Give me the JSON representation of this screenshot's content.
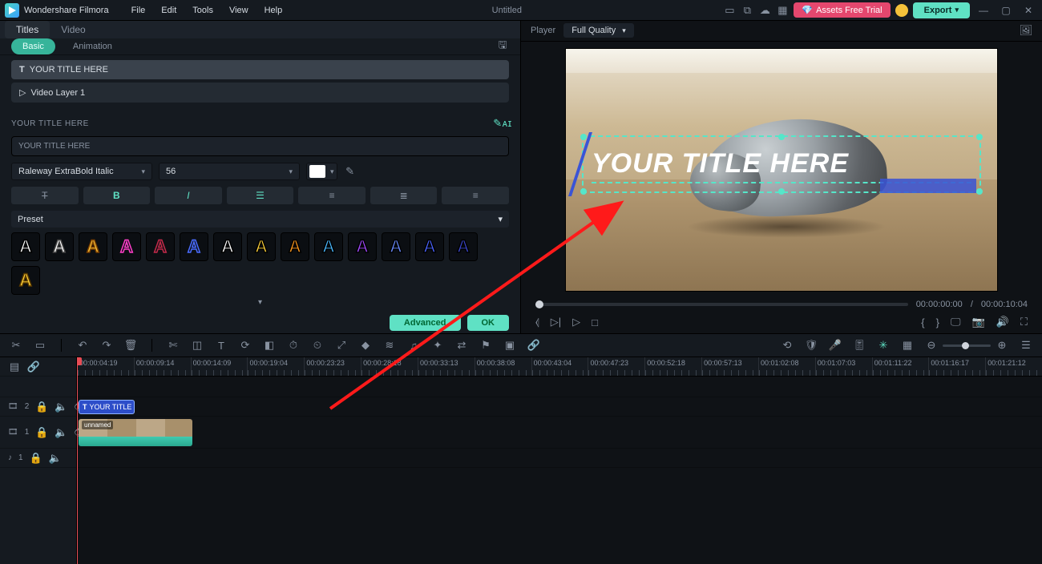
{
  "app": {
    "name": "Wondershare Filmora",
    "doc_title": "Untitled"
  },
  "menu": {
    "file": "File",
    "edit": "Edit",
    "tools": "Tools",
    "view": "View",
    "help": "Help"
  },
  "header_buttons": {
    "assets": "Assets Free Trial",
    "export": "Export"
  },
  "left": {
    "tabs": {
      "titles": "Titles",
      "video": "Video"
    },
    "subtabs": {
      "basic": "Basic",
      "animation": "Animation"
    },
    "layers": {
      "title": "YOUR TITLE HERE",
      "video": "Video Layer 1"
    },
    "section_label": "YOUR TITLE HERE",
    "text_value": "YOUR TITLE HERE",
    "font": {
      "family": "Raleway ExtraBold Italic",
      "size": "56"
    },
    "preset_label": "Preset",
    "buttons": {
      "advanced": "Advanced",
      "ok": "OK"
    }
  },
  "player": {
    "label": "Player",
    "quality": "Full Quality",
    "title_overlay": "YOUR TITLE HERE",
    "time_current": "00:00:00:00",
    "time_total": "00:00:10:04",
    "time_sep": "/"
  },
  "timeline": {
    "ticks": [
      "00:00:04:19",
      "00:00:09:14",
      "00:00:14:09",
      "00:00:19:04",
      "00:00:23:23",
      "00:00:28:18",
      "00:00:33:13",
      "00:00:38:08",
      "00:00:43:04",
      "00:00:47:23",
      "00:00:52:18",
      "00:00:57:13",
      "00:01:02:08",
      "00:01:07:03",
      "00:01:11:22",
      "00:01:16:17",
      "00:01:21:12"
    ],
    "tracks": {
      "t2_label": "2",
      "t1_label": "1",
      "a1_label": "1"
    },
    "title_clip": "YOUR TITLE HE...",
    "video_clip": "unnamed"
  },
  "preset_styles": [
    {
      "fill": "#ffffff",
      "stroke": "#000"
    },
    {
      "fill": "#ffffff",
      "stroke": "#444"
    },
    {
      "fill": "#f5c23a",
      "stroke": "#7a3e00"
    },
    {
      "fill": "transparent",
      "stroke": "#ff3ec9"
    },
    {
      "fill": "transparent",
      "stroke": "#c22a4a"
    },
    {
      "fill": "transparent",
      "stroke": "#4a6cff"
    },
    {
      "fill": "#ffffff",
      "stroke": "#000"
    },
    {
      "fill": "#ffd23a",
      "stroke": "#000"
    },
    {
      "fill": "#ff9a1e",
      "stroke": "#000"
    },
    {
      "fill": "#4ab9ff",
      "stroke": "#000"
    },
    {
      "fill": "#a24aff",
      "stroke": "#000"
    },
    {
      "fill": "#6a8bff",
      "stroke": "#000"
    },
    {
      "fill": "#4a64ff",
      "stroke": "#000"
    },
    {
      "fill": "#3a46c8",
      "stroke": "#000"
    },
    {
      "fill": "#ffd23a",
      "stroke": "#5a3a00"
    }
  ]
}
